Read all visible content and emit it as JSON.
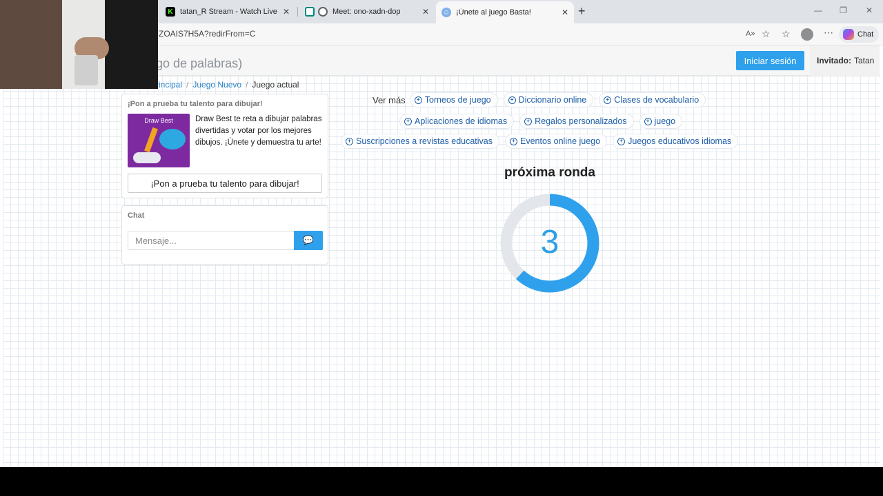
{
  "browser": {
    "tabs": [
      {
        "title": "tatan_R Stream - Watch Live on Ki",
        "favicon": "kick-logo-icon",
        "active": false
      },
      {
        "title": "Meet: ono-xadn-dop",
        "favicon": "meet-icon",
        "active": false
      },
      {
        "title": "¡Únete al juego Basta!",
        "favicon": "game-icon",
        "active": true
      }
    ],
    "url": "ZOAIS7H5A?redirFrom=C",
    "chat_label": "Chat"
  },
  "header": {
    "brand": "go de palabras)",
    "login_label": "Iniciar sesión",
    "guest_label": "Invitado:",
    "guest_name": "Tatan"
  },
  "breadcrumb": {
    "home": "rincipal",
    "new_game": "Juego Nuevo",
    "current": "Juego actual"
  },
  "promo": {
    "heading": "¡Pon a prueba tu talento para dibujar!",
    "image_title": "Draw Best",
    "text": "Draw Best te reta a dibujar palabras divertidas y votar por los mejores dibujos. ¡Únete y demuestra tu arte!",
    "button": "¡Pon a prueba tu talento para dibujar!"
  },
  "chat": {
    "heading": "Chat",
    "placeholder": "Mensaje..."
  },
  "ads": {
    "ver_mas": "Ver más",
    "row1": [
      "Torneos de juego",
      "Diccionario online",
      "Clases de vocabulario"
    ],
    "row2": [
      "Aplicaciones de idiomas",
      "Regalos personalizados",
      "juego"
    ],
    "row3": [
      "Suscripciones a revistas educativas",
      "Eventos online juego",
      "Juegos educativos idiomas"
    ]
  },
  "round": {
    "title": "próxima ronda",
    "countdown": "3",
    "progress_fraction": 0.62
  },
  "colors": {
    "accent": "#2fa1ec",
    "link": "#1f5fa8",
    "ring_track": "#e3e6ea"
  }
}
